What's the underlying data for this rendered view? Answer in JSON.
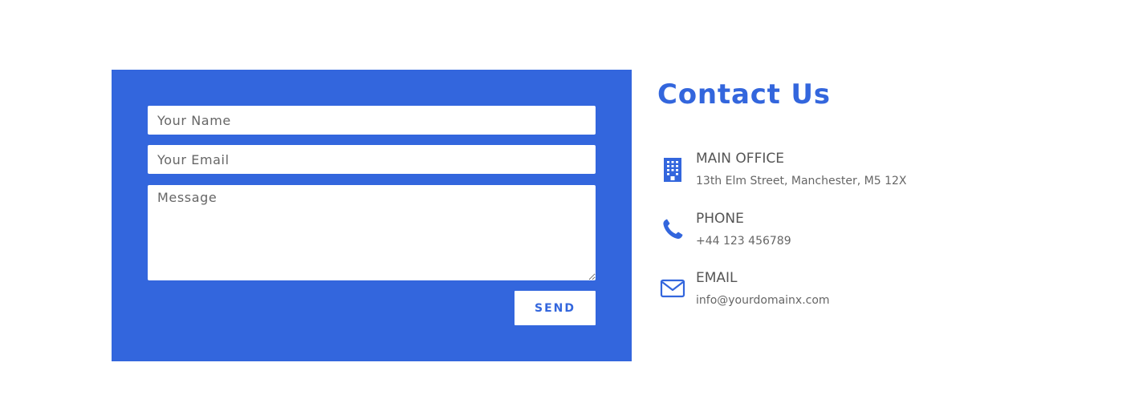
{
  "form": {
    "name_placeholder": "Your Name",
    "email_placeholder": "Your Email",
    "message_placeholder": "Message",
    "send_label": "SEND"
  },
  "contact": {
    "title": "Contact Us",
    "items": [
      {
        "icon": "building-icon",
        "label": "MAIN OFFICE",
        "value": "13th Elm Street, Manchester, M5 12X"
      },
      {
        "icon": "phone-icon",
        "label": "PHONE",
        "value": "+44 123 456789"
      },
      {
        "icon": "envelope-icon",
        "label": "EMAIL",
        "value": "info@yourdomainx.com"
      }
    ]
  },
  "colors": {
    "accent": "#3366dd",
    "text": "#555555",
    "background": "#ffffff"
  }
}
